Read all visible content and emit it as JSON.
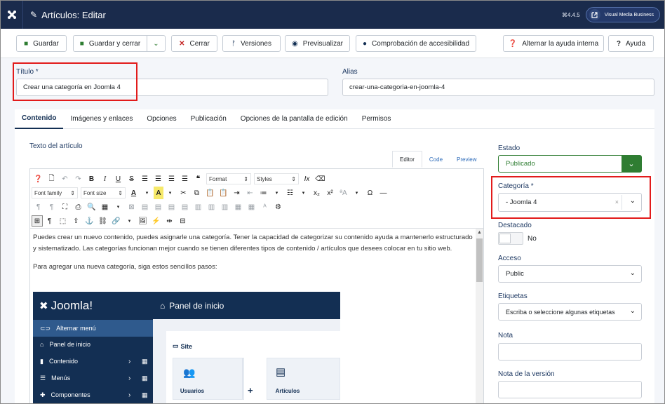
{
  "header": {
    "title": "Artículos: Editar",
    "version": "⌘4.4.5",
    "site_label": "Visual Media Business"
  },
  "toolbar": {
    "save": "Guardar",
    "save_close": "Guardar y cerrar",
    "close": "Cerrar",
    "versions": "Versiones",
    "preview": "Previsualizar",
    "accessibility": "Comprobación de accesibilidad",
    "toggle_help": "Alternar la ayuda interna",
    "help": "Ayuda"
  },
  "form": {
    "title_label": "Título *",
    "title_value": "Crear una categoría en Joomla 4",
    "alias_label": "Alias",
    "alias_value": "crear-una-categoria-en-joomla-4"
  },
  "tabs": [
    "Contenido",
    "Imágenes y enlaces",
    "Opciones",
    "Publicación",
    "Opciones de la pantalla de edición",
    "Permisos"
  ],
  "editor": {
    "label": "Texto del artículo",
    "modes": [
      "Editor",
      "Code",
      "Preview"
    ],
    "format_select": "Format",
    "styles_select": "Styles",
    "font_family": "Font family",
    "font_size": "Font size",
    "paragraph1": "Puedes crear un nuevo contenido, puedes asignarle una categoría. Tener la capacidad de categorizar su contenido ayuda a mantenerlo estructurado y sistematizado. Las categorías funcionan mejor cuando se tienen diferentes tipos de contenido / artículos que desees colocar en tu sitio web.",
    "paragraph2": "Para agregar una nueva categoría, siga estos sencillos pasos:"
  },
  "embedded_screenshot": {
    "logo": "Joomla!",
    "top_title": "Panel de inicio",
    "menu": [
      "Alternar menú",
      "Panel de inicio",
      "Contenido",
      "Menús",
      "Componentes"
    ],
    "site_heading": "Site",
    "card_users": "Usuarios",
    "card_articles": "Artículos"
  },
  "sidebar": {
    "state_label": "Estado",
    "state_value": "Publicado",
    "category_label": "Categoría *",
    "category_value": "- Joomla 4",
    "featured_label": "Destacado",
    "featured_value": "No",
    "access_label": "Acceso",
    "access_value": "Public",
    "tags_label": "Etiquetas",
    "tags_placeholder": "Escriba o seleccione algunas etiquetas",
    "note_label": "Nota",
    "version_note_label": "Nota de la versión"
  },
  "colors": {
    "header_bg": "#1a2b4c",
    "published_green": "#2f7d32",
    "highlight_red": "#e21b1b"
  }
}
